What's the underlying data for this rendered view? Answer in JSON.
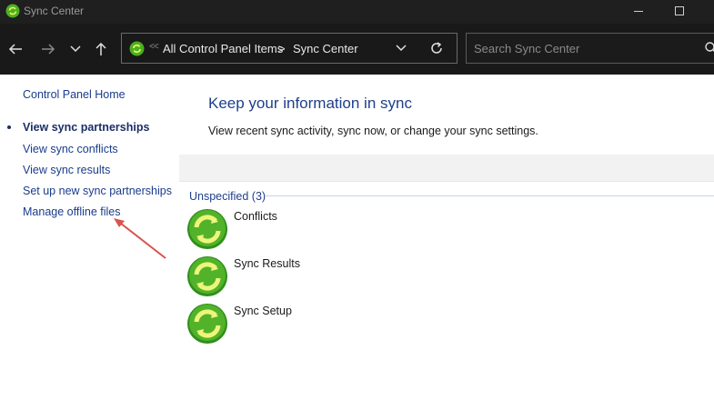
{
  "window": {
    "title": "Sync Center"
  },
  "address": {
    "crumbs": [
      "All Control Panel Items",
      "Sync Center"
    ],
    "separator": ">"
  },
  "search": {
    "placeholder": "Search Sync Center"
  },
  "sidebar": {
    "items": [
      {
        "label": "Control Panel Home"
      },
      {
        "label": "View sync partnerships",
        "active": true
      },
      {
        "label": "View sync conflicts"
      },
      {
        "label": "View sync results"
      },
      {
        "label": "Set up new sync partnerships"
      },
      {
        "label": "Manage offline files"
      }
    ]
  },
  "main": {
    "heading": "Keep your information in sync",
    "description": "View recent sync activity, sync now, or change your sync settings.",
    "group_label": "Unspecified (3)",
    "items": [
      {
        "label": "Conflicts",
        "icon": "sync-icon"
      },
      {
        "label": "Sync Results",
        "icon": "sync-icon"
      },
      {
        "label": "Sync Setup",
        "icon": "sync-icon"
      }
    ]
  },
  "colors": {
    "accent": "#1e3f8a",
    "sync_green": "#4caf1f",
    "annotation_arrow": "#d9534f"
  }
}
